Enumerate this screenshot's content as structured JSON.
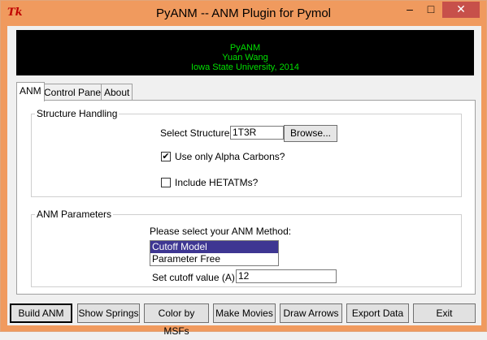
{
  "window": {
    "title": "PyANM -- ANM Plugin for Pymol",
    "icon_glyph": "Tk",
    "controls": {
      "minimize": "–",
      "maximize": "□",
      "close": "✕"
    }
  },
  "banner": {
    "line1": "PyANM",
    "line2": "Yuan Wang",
    "line3": "Iowa State University, 2014"
  },
  "tabs": [
    {
      "label": "ANM",
      "active": true
    },
    {
      "label": "Control Panel",
      "active": false
    },
    {
      "label": "About",
      "active": false
    }
  ],
  "structure_group": {
    "title": "Structure Handling",
    "select_label": "Select Structure:",
    "select_value": "1T3R",
    "browse_label": "Browse...",
    "alpha_label": "Use only Alpha Carbons?",
    "alpha_checked": true,
    "hetatm_label": "Include HETATMs?",
    "hetatm_checked": false
  },
  "params_group": {
    "title": "ANM Parameters",
    "method_prompt": "Please select your ANM Method:",
    "methods": [
      {
        "label": "Cutoff Model",
        "selected": true
      },
      {
        "label": "Parameter Free",
        "selected": false
      }
    ],
    "cutoff_label": "Set cutoff value (A):",
    "cutoff_value": "12"
  },
  "buttons": {
    "build": "Build ANM",
    "springs": "Show Springs",
    "color": "Color by MSFs",
    "movies": "Make Movies",
    "arrows": "Draw Arrows",
    "export": "Export Data",
    "exit": "Exit"
  },
  "colors": {
    "titlebar": "#f09a5e",
    "banner_bg": "#000000",
    "banner_text": "#00e000",
    "selection": "#3e3692"
  }
}
